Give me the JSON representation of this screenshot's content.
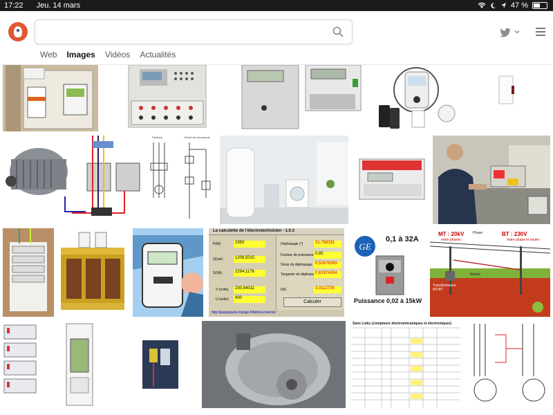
{
  "status_bar": {
    "time": "17:22",
    "date": "Jeu. 14 mars",
    "battery": "47 %",
    "battery_level": 0.47
  },
  "search": {
    "value": "",
    "placeholder": ""
  },
  "tabs": [
    {
      "label": "Web",
      "active": false
    },
    {
      "label": "Images",
      "active": true
    },
    {
      "label": "Vidéos",
      "active": false
    },
    {
      "label": "Actualités",
      "active": false
    }
  ],
  "icons": [
    "duckduckgo-logo",
    "search-icon",
    "twitter-icon",
    "chevron-down-icon",
    "menu-icon",
    "wifi-icon",
    "moon-icon",
    "location-icon",
    "battery-icon"
  ],
  "accent": "#de5833",
  "results": {
    "calc_title": "La calculette de l'électrotechnicien - 1.0.3",
    "calc_fields": [
      {
        "label": "P(W)",
        "value": "1950"
      },
      {
        "label": "Q(var)",
        "value": "1208,5015"
      },
      {
        "label": "S(VA)",
        "value": "2294,1176"
      },
      {
        "label": "V (volts)",
        "value": "230,94011"
      },
      {
        "label": "U (volts)",
        "value": "400"
      }
    ],
    "calc_right": [
      {
        "label": "Déphasage (°)",
        "value": "31,788331"
      },
      {
        "label": "Facteur de puissance",
        "value": "0,85"
      },
      {
        "label": "Sinus du déphasage",
        "value": "0,52678269"
      },
      {
        "label": "Tangente du déphasage",
        "value": "0,61974434"
      },
      {
        "label": "I(A)",
        "value": "3,3112735"
      }
    ],
    "calc_button": "Calculer",
    "calc_url": "http://paqueparis.orange.fr/fabrice.mercier",
    "ge_range": "0,1 à 32A",
    "ge_power": "Puissance 0,02 à 15kW",
    "mt_label": "MT : 20kV",
    "mt_sub": "entre phases",
    "bt_label": "BT : 230V",
    "bt_sub": "entre phase et neutre",
    "transfo_label": "Transformateur MT/BT",
    "phase_label": "Phase",
    "neutre_label": "Neutre",
    "linky_title": "Sans Linky (compteurs électromécaniques et électroniques)",
    "schema_label": "Schéma",
    "schema_title": "Circuit de commande"
  }
}
